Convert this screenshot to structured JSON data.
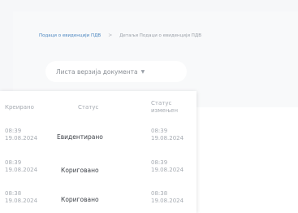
{
  "breadcrumb": {
    "link": "Подаци о евиденцији ПДВ",
    "separator": ">",
    "current": "Детаљи Подаци о евиденцији ПДВ"
  },
  "versions_button": {
    "label": "Листа верзија документа",
    "icon": "chevron-down-icon"
  },
  "versions_table": {
    "headers": {
      "created": "Креирано",
      "status": "Статус",
      "status_changed_line1": "Статус",
      "status_changed_line2": "измењен"
    },
    "rows": [
      {
        "created_time": "08:39",
        "created_date": "19.08.2024",
        "status": "Евидентирано",
        "changed_time": "08:39",
        "changed_date": "19.08.2024"
      },
      {
        "created_time": "08:39",
        "created_date": "19.08.2024",
        "status": "Кориговано",
        "changed_time": "08:39",
        "changed_date": "19.08.2024"
      },
      {
        "created_time": "08:38",
        "created_date": "19.08.2024",
        "status": "Кориговано",
        "changed_time": "08:38",
        "changed_date": "19.08.2024"
      }
    ]
  }
}
